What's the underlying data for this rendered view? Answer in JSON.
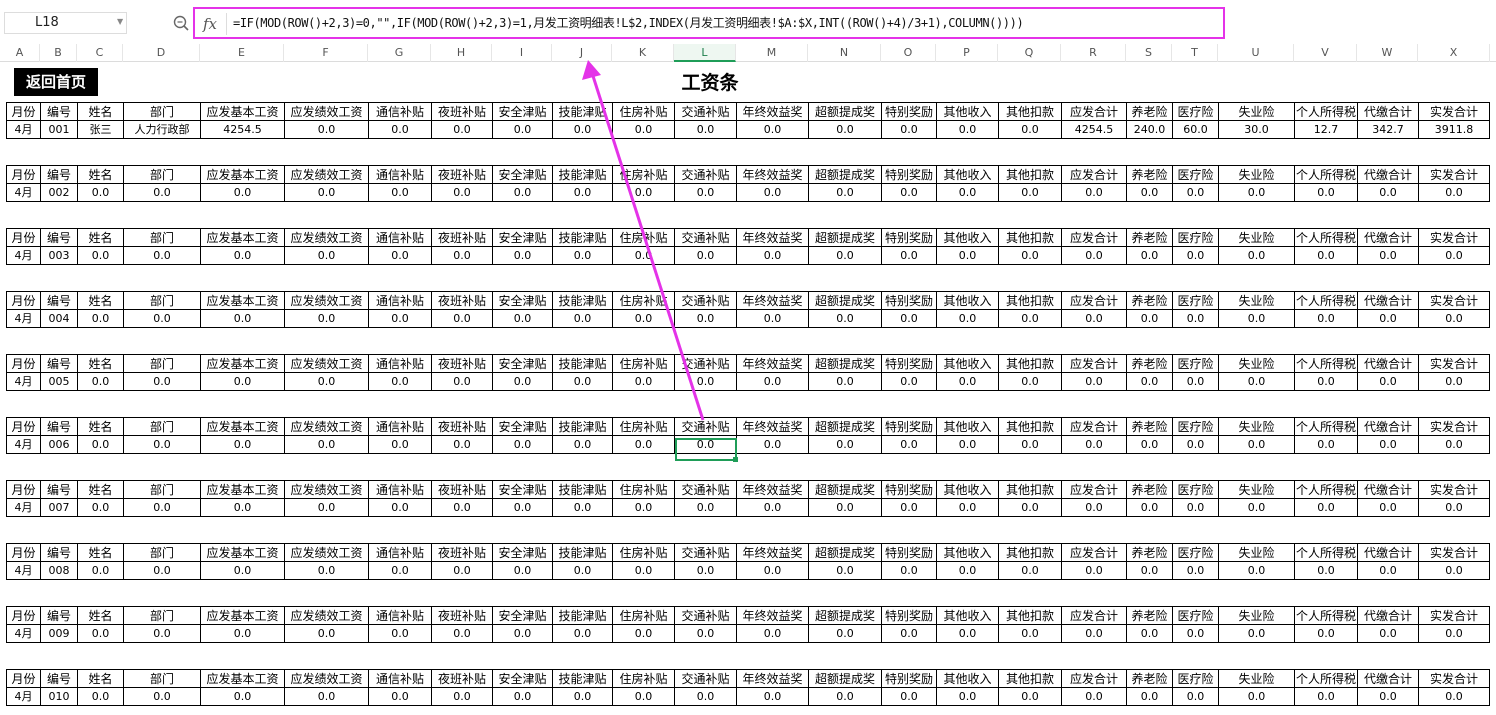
{
  "name_box": "L18",
  "formula": "=IF(MOD(ROW()+2,3)=0,\"\",IF(MOD(ROW()+2,3)=1,月发工资明细表!L$2,INDEX(月发工资明细表!$A:$X,INT((ROW()+4)/3+1),COLUMN())))",
  "fx_label": "fx",
  "columns": [
    "A",
    "B",
    "C",
    "D",
    "E",
    "F",
    "G",
    "H",
    "I",
    "J",
    "K",
    "L",
    "M",
    "N",
    "O",
    "P",
    "Q",
    "R",
    "S",
    "T",
    "U",
    "V",
    "W",
    "X"
  ],
  "selected_column": "L",
  "home_button": "返回首页",
  "title": "工资条",
  "headers": [
    "月份",
    "编号",
    "姓名",
    "部门",
    "应发基本工资",
    "应发绩效工资",
    "通信补贴",
    "夜班补贴",
    "安全津贴",
    "技能津贴",
    "住房补贴",
    "交通补贴",
    "年终效益奖",
    "超额提成奖",
    "特别奖励",
    "其他收入",
    "其他扣款",
    "应发合计",
    "养老险",
    "医疗险",
    "失业险",
    "个人所得税",
    "代缴合计",
    "实发合计"
  ],
  "rows": [
    [
      "4月",
      "001",
      "张三",
      "人力行政部",
      "4254.5",
      "0.0",
      "0.0",
      "0.0",
      "0.0",
      "0.0",
      "0.0",
      "0.0",
      "0.0",
      "0.0",
      "0.0",
      "0.0",
      "0.0",
      "4254.5",
      "240.0",
      "60.0",
      "30.0",
      "12.7",
      "342.7",
      "3911.8"
    ],
    [
      "4月",
      "002",
      "0.0",
      "0.0",
      "0.0",
      "0.0",
      "0.0",
      "0.0",
      "0.0",
      "0.0",
      "0.0",
      "0.0",
      "0.0",
      "0.0",
      "0.0",
      "0.0",
      "0.0",
      "0.0",
      "0.0",
      "0.0",
      "0.0",
      "0.0",
      "0.0",
      "0.0"
    ],
    [
      "4月",
      "003",
      "0.0",
      "0.0",
      "0.0",
      "0.0",
      "0.0",
      "0.0",
      "0.0",
      "0.0",
      "0.0",
      "0.0",
      "0.0",
      "0.0",
      "0.0",
      "0.0",
      "0.0",
      "0.0",
      "0.0",
      "0.0",
      "0.0",
      "0.0",
      "0.0",
      "0.0"
    ],
    [
      "4月",
      "004",
      "0.0",
      "0.0",
      "0.0",
      "0.0",
      "0.0",
      "0.0",
      "0.0",
      "0.0",
      "0.0",
      "0.0",
      "0.0",
      "0.0",
      "0.0",
      "0.0",
      "0.0",
      "0.0",
      "0.0",
      "0.0",
      "0.0",
      "0.0",
      "0.0",
      "0.0"
    ],
    [
      "4月",
      "005",
      "0.0",
      "0.0",
      "0.0",
      "0.0",
      "0.0",
      "0.0",
      "0.0",
      "0.0",
      "0.0",
      "0.0",
      "0.0",
      "0.0",
      "0.0",
      "0.0",
      "0.0",
      "0.0",
      "0.0",
      "0.0",
      "0.0",
      "0.0",
      "0.0",
      "0.0"
    ],
    [
      "4月",
      "006",
      "0.0",
      "0.0",
      "0.0",
      "0.0",
      "0.0",
      "0.0",
      "0.0",
      "0.0",
      "0.0",
      "0.0",
      "0.0",
      "0.0",
      "0.0",
      "0.0",
      "0.0",
      "0.0",
      "0.0",
      "0.0",
      "0.0",
      "0.0",
      "0.0",
      "0.0"
    ],
    [
      "4月",
      "007",
      "0.0",
      "0.0",
      "0.0",
      "0.0",
      "0.0",
      "0.0",
      "0.0",
      "0.0",
      "0.0",
      "0.0",
      "0.0",
      "0.0",
      "0.0",
      "0.0",
      "0.0",
      "0.0",
      "0.0",
      "0.0",
      "0.0",
      "0.0",
      "0.0",
      "0.0"
    ],
    [
      "4月",
      "008",
      "0.0",
      "0.0",
      "0.0",
      "0.0",
      "0.0",
      "0.0",
      "0.0",
      "0.0",
      "0.0",
      "0.0",
      "0.0",
      "0.0",
      "0.0",
      "0.0",
      "0.0",
      "0.0",
      "0.0",
      "0.0",
      "0.0",
      "0.0",
      "0.0",
      "0.0"
    ],
    [
      "4月",
      "009",
      "0.0",
      "0.0",
      "0.0",
      "0.0",
      "0.0",
      "0.0",
      "0.0",
      "0.0",
      "0.0",
      "0.0",
      "0.0",
      "0.0",
      "0.0",
      "0.0",
      "0.0",
      "0.0",
      "0.0",
      "0.0",
      "0.0",
      "0.0",
      "0.0",
      "0.0"
    ],
    [
      "4月",
      "010",
      "0.0",
      "0.0",
      "0.0",
      "0.0",
      "0.0",
      "0.0",
      "0.0",
      "0.0",
      "0.0",
      "0.0",
      "0.0",
      "0.0",
      "0.0",
      "0.0",
      "0.0",
      "0.0",
      "0.0",
      "0.0",
      "0.0",
      "0.0",
      "0.0",
      "0.0"
    ]
  ],
  "colors": {
    "annotation": "#e433e8",
    "selection": "#1f9d58"
  }
}
